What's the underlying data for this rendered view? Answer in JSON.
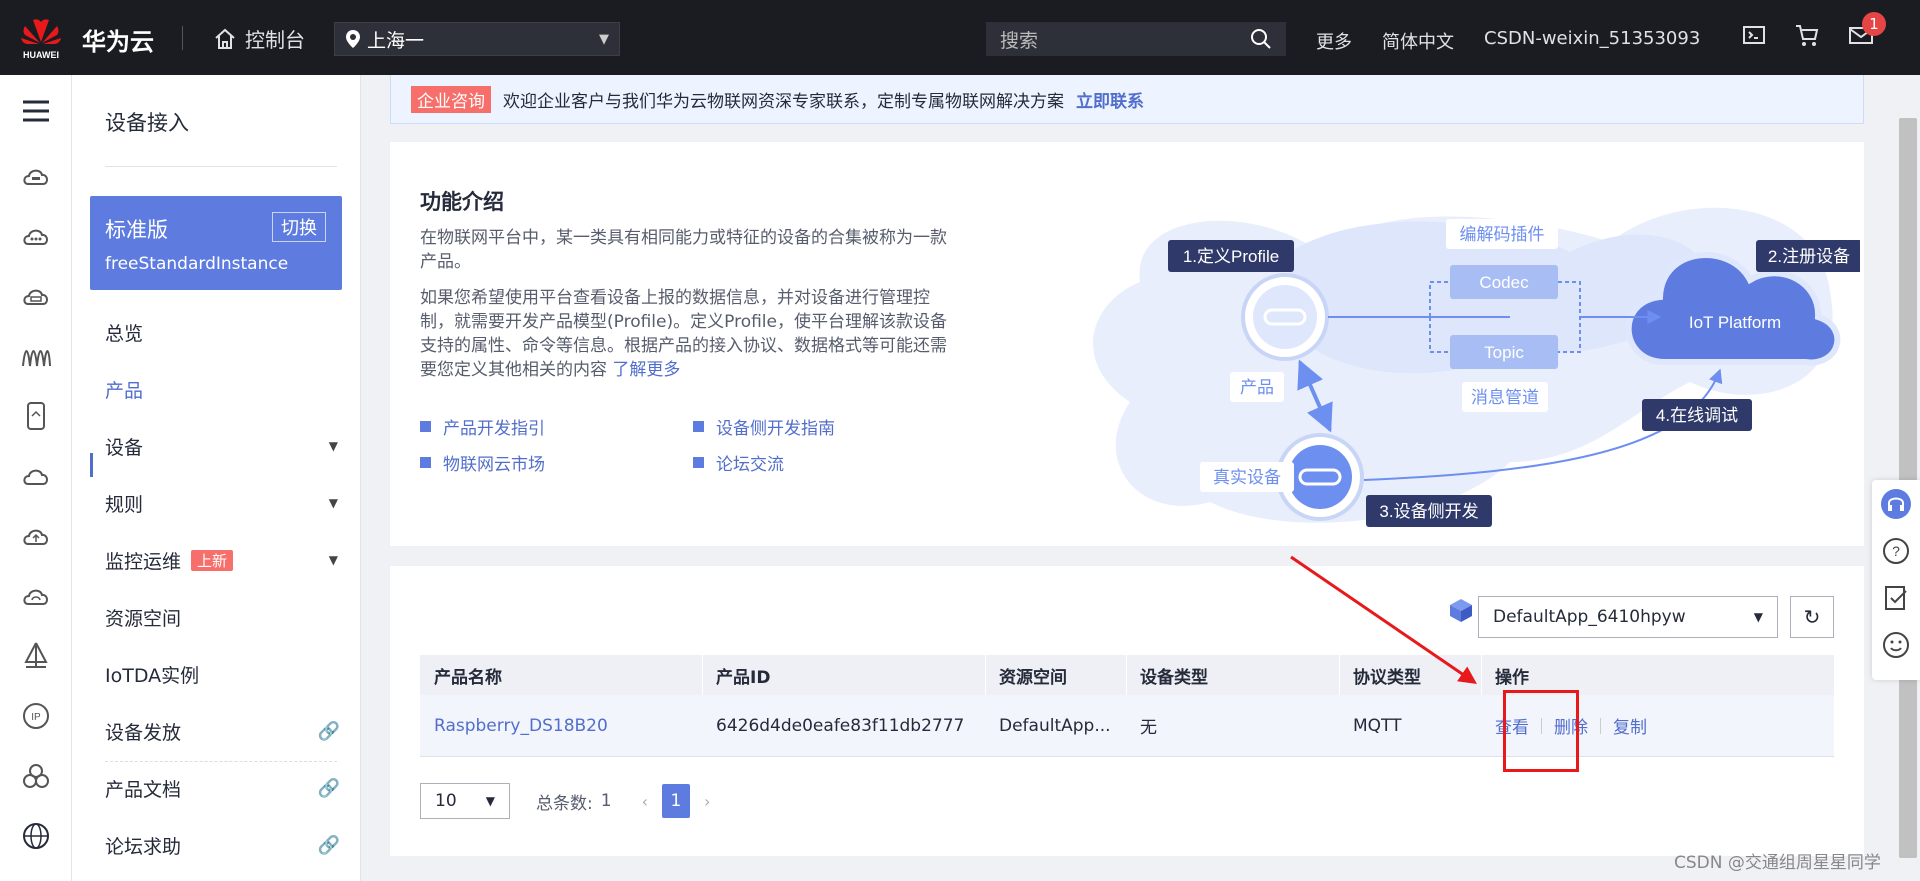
{
  "topbar": {
    "logo_text": "HUAWEI",
    "brand": "华为云",
    "console_label": "控制台",
    "region": "上海一",
    "search_placeholder": "搜索",
    "more": "更多",
    "language": "简体中文",
    "user": "CSDN-weixin_51353093",
    "mail_badge": "1"
  },
  "icon_rail": [
    "menu-icon",
    "cloud-device-icon",
    "cloud-chat-icon",
    "cloud-storage-icon",
    "network-wave-icon",
    "phone-icon",
    "cloud-outline-icon",
    "cloud-upload-icon",
    "cloud-sync-icon",
    "sail-icon",
    "ip-icon",
    "cluster-icon",
    "global-icon"
  ],
  "sidenav": {
    "title": "设备接入",
    "edition": {
      "name": "标准版",
      "switch": "切换",
      "instance": "freeStandardInstance"
    },
    "items": [
      {
        "label": "总览"
      },
      {
        "label": "产品"
      },
      {
        "label": "设备"
      },
      {
        "label": "规则"
      },
      {
        "label": "监控运维",
        "tag": "上新"
      },
      {
        "label": "资源空间"
      },
      {
        "label": "IoTDA实例"
      },
      {
        "label": "设备发放"
      },
      {
        "label": "产品文档"
      },
      {
        "label": "论坛求助"
      }
    ]
  },
  "notice": {
    "tag": "企业咨询",
    "text": "欢迎企业客户与我们华为云物联网资深专家联系，定制专属物联网解决方案",
    "link": "立即联系"
  },
  "intro": {
    "title": "功能介绍",
    "p1": "在物联网平台中，某一类具有相同能力或特征的设备的合集被称为一款产品。",
    "p2": "如果您希望使用平台查看设备上报的数据信息，并对设备进行管理控制，就需要开发产品模型(Profile)。定义Profile，使平台理解该款设备支持的属性、命令等信息。根据产品的接入协议、数据格式等可能还需要您定义其他相关的内容",
    "p2_more": "了解更多",
    "links": [
      "产品开发指引",
      "设备侧开发指南",
      "物联网云市场",
      "论坛交流"
    ],
    "diagram": {
      "step1": "1.定义Profile",
      "step2": "2.注册设备",
      "step3": "3.设备侧开发",
      "step4": "4.在线调试",
      "product": "产品",
      "real_device": "真实设备",
      "codec_plugin": "编解码插件",
      "codec": "Codec",
      "topic": "Topic",
      "msg_pipe": "消息管道",
      "platform": "IoT Platform"
    }
  },
  "list": {
    "app": "DefaultApp_6410hpyw",
    "columns": [
      "产品名称",
      "产品ID",
      "资源空间",
      "设备类型",
      "协议类型",
      "操作"
    ],
    "rows": [
      {
        "name": "Raspberry_DS18B20",
        "id": "6426d4de0eafe83f11db2777",
        "space": "DefaultApp...",
        "type": "无",
        "protocol": "MQTT"
      }
    ],
    "actions": [
      "查看",
      "删除",
      "复制"
    ],
    "pager": {
      "size": "10",
      "total_label": "总条数:",
      "total": "1",
      "page": "1"
    }
  },
  "watermark": "CSDN @交通组周星星同学",
  "colors": {
    "accent": "#5e7ce0",
    "highlight": "#e8191a",
    "topbar": "#1a1c22"
  }
}
